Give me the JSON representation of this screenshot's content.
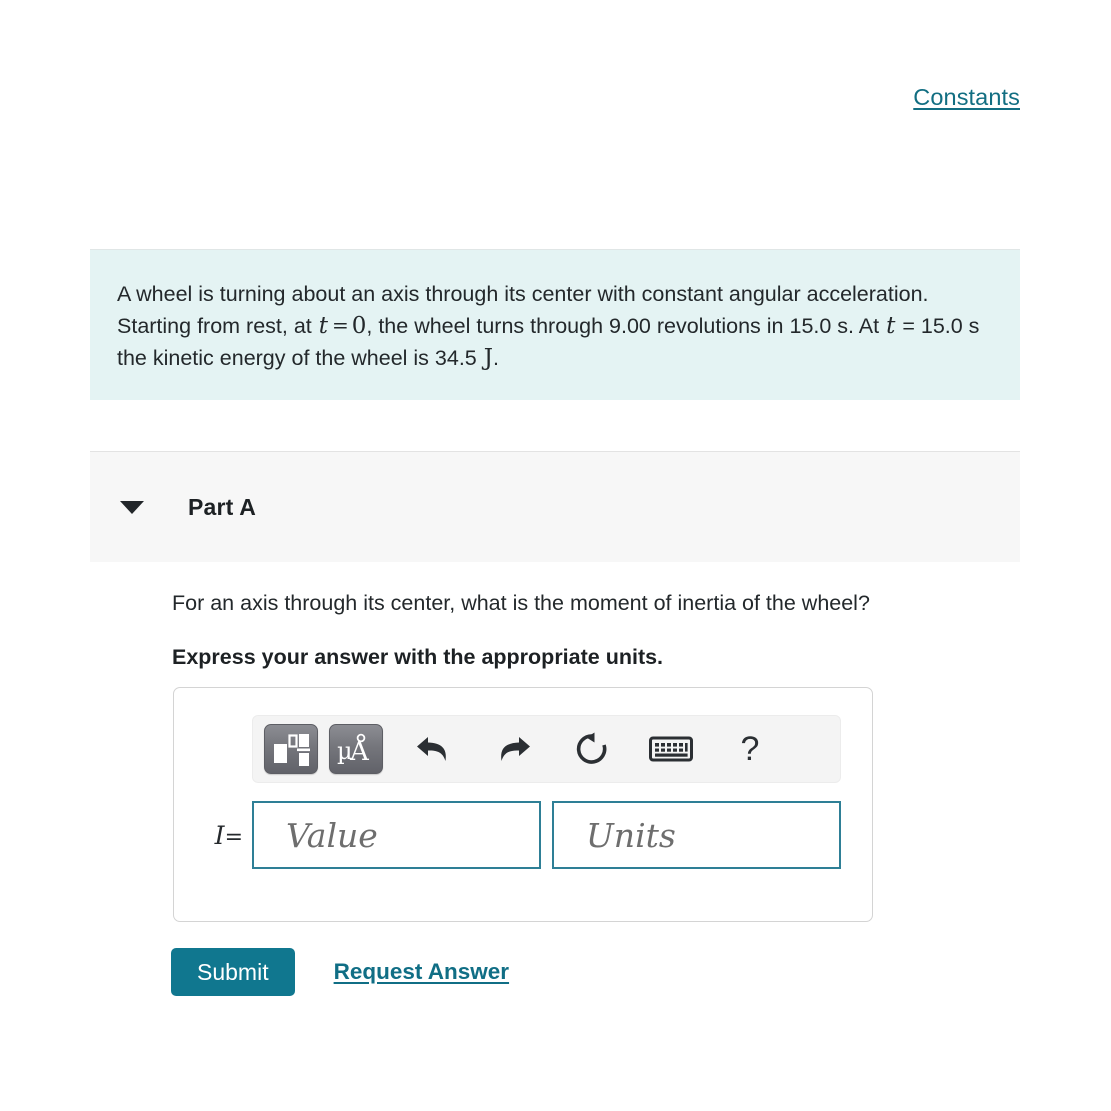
{
  "header": {
    "constants_label": "Constants"
  },
  "problem": {
    "seg1": "A wheel is turning about an axis through its center with constant angular acceleration. Starting from rest, at ",
    "var_t1": "t",
    "eq1": "=",
    "num_zero": "0",
    "seg2": ", the wheel turns through 9.00 revolutions in 15.0 s. At ",
    "var_t2": "t",
    "seg3": " = 15.0 s the kinetic energy of the wheel is 34.5 ",
    "unit_j": "J",
    "seg4": "."
  },
  "part": {
    "caret_icon": "chevron-down-icon",
    "title": "Part A",
    "question": "For an axis through its center, what is the moment of inertia of the wheel?",
    "instruction": "Express your answer with the appropriate units."
  },
  "toolbar": {
    "buttons": [
      {
        "name": "math-template-icon",
        "label": "Math template"
      },
      {
        "name": "units-icon",
        "label": "µÅ"
      },
      {
        "name": "undo-icon",
        "label": "Undo"
      },
      {
        "name": "redo-icon",
        "label": "Redo"
      },
      {
        "name": "reset-icon",
        "label": "Reset"
      },
      {
        "name": "keyboard-icon",
        "label": "Keyboard"
      },
      {
        "name": "help-icon",
        "label": "?"
      }
    ],
    "help_glyph": "?"
  },
  "answer": {
    "variable": "I",
    "equals": "=",
    "value_placeholder": "Value",
    "units_placeholder": "Units",
    "value": "",
    "units": ""
  },
  "actions": {
    "submit_label": "Submit",
    "request_answer_label": "Request Answer"
  },
  "colors": {
    "accent_teal": "#10778f",
    "link_teal": "#126e82",
    "problem_bg": "#e4f3f3",
    "part_header_bg": "#f7f7f7",
    "field_border": "#2e7f96"
  }
}
